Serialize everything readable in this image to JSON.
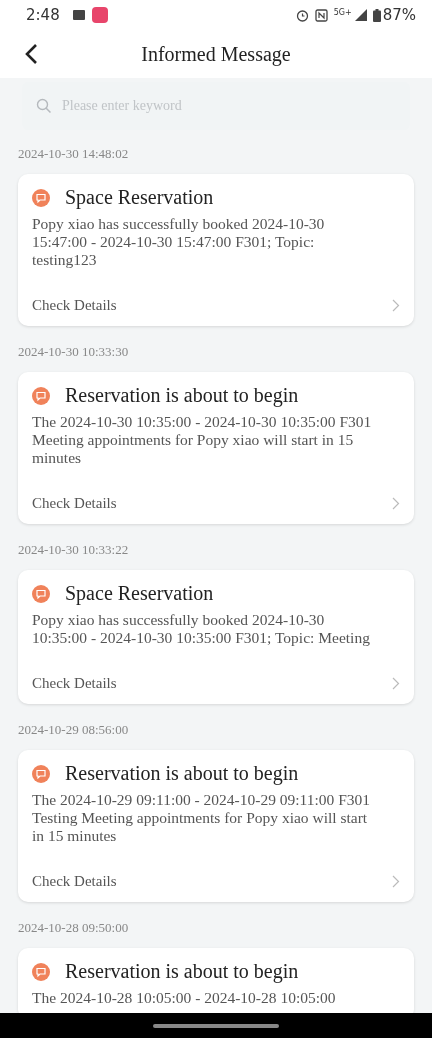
{
  "status_bar": {
    "time": "2:48",
    "network": "5G+",
    "battery": "87%"
  },
  "header": {
    "title": "Informed Message"
  },
  "search": {
    "placeholder": "Please enter keyword"
  },
  "messages": [
    {
      "time": "2024-10-30 14:48:02",
      "title": "Space Reservation",
      "body": "Popy xiao has successfully booked 2024-10-30 15:47:00 - 2024-10-30 15:47:00 F301; Topic: testing123",
      "action": "Check Details"
    },
    {
      "time": "2024-10-30 10:33:30",
      "title": "Reservation is about to begin",
      "body": "The 2024-10-30 10:35:00 - 2024-10-30 10:35:00 F301 Meeting appointments for Popy xiao will start in 15 minutes",
      "action": "Check Details"
    },
    {
      "time": "2024-10-30 10:33:22",
      "title": "Space Reservation",
      "body": "Popy xiao has successfully booked 2024-10-30 10:35:00 - 2024-10-30 10:35:00 F301; Topic: Meeting",
      "action": "Check Details"
    },
    {
      "time": "2024-10-29 08:56:00",
      "title": "Reservation is about to begin",
      "body": "The 2024-10-29 09:11:00 - 2024-10-29 09:11:00 F301 Testing Meeting appointments for Popy xiao will start in 15 minutes",
      "action": "Check Details"
    },
    {
      "time": "2024-10-28 09:50:00",
      "title": "Reservation is about to begin",
      "body": "The 2024-10-28 10:05:00 - 2024-10-28 10:05:00"
    }
  ]
}
